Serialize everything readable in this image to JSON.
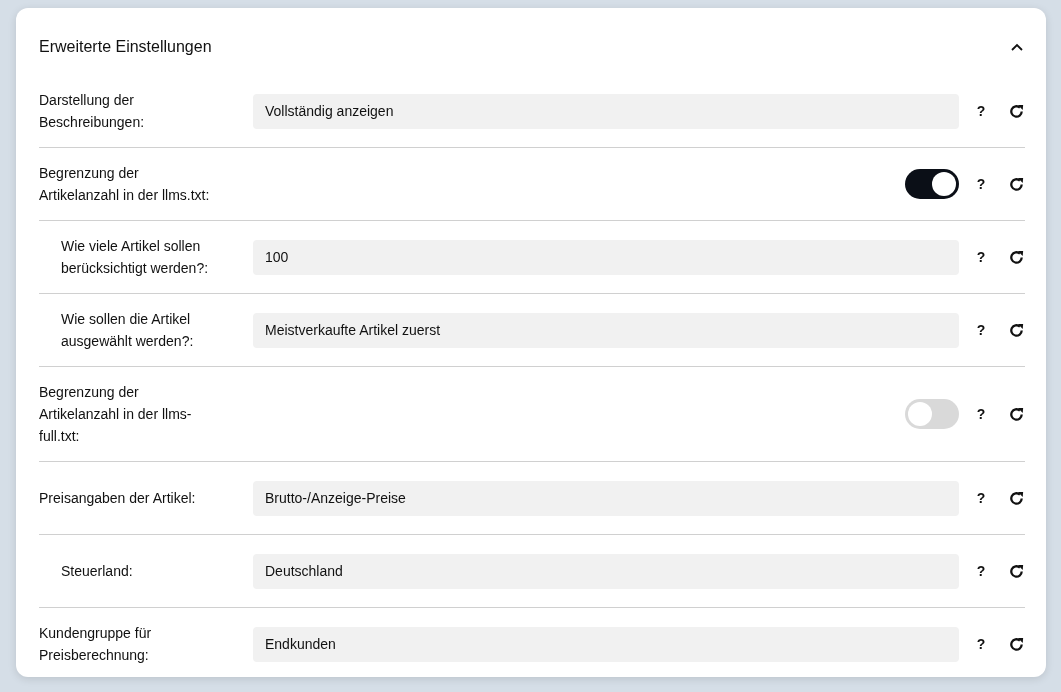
{
  "panel": {
    "title": "Erweiterte Einstellungen",
    "expanded": true,
    "settings": [
      {
        "kind": "field",
        "label": "Darstellung der Beschreibungen:",
        "value": "Vollständig anzeigen",
        "help": "?"
      },
      {
        "kind": "toggle",
        "label": "Begrenzung der Artikelanzahl in der llms.txt:",
        "on": true,
        "help": "?",
        "children": [
          {
            "kind": "field",
            "label": "Wie viele Artikel sollen berücksichtigt werden?:",
            "value": "100",
            "help": "?"
          },
          {
            "kind": "field",
            "label": "Wie sollen die Artikel ausgewählt werden?:",
            "value": "Meistverkaufte Artikel zuerst",
            "help": "?"
          }
        ]
      },
      {
        "kind": "toggle",
        "label": "Begrenzung der Artikelanzahl in der llms-full.txt:",
        "on": false,
        "help": "?"
      },
      {
        "kind": "field",
        "label": "Preisangaben der Artikel:",
        "value": "Brutto-/Anzeige-Preise",
        "help": "?",
        "children": [
          {
            "kind": "field",
            "label": "Steuerland:",
            "value": "Deutschland",
            "help": "?"
          }
        ]
      },
      {
        "kind": "field",
        "label": "Kundengruppe für Preisberechnung:",
        "value": "Endkunden",
        "help": "?"
      }
    ]
  }
}
